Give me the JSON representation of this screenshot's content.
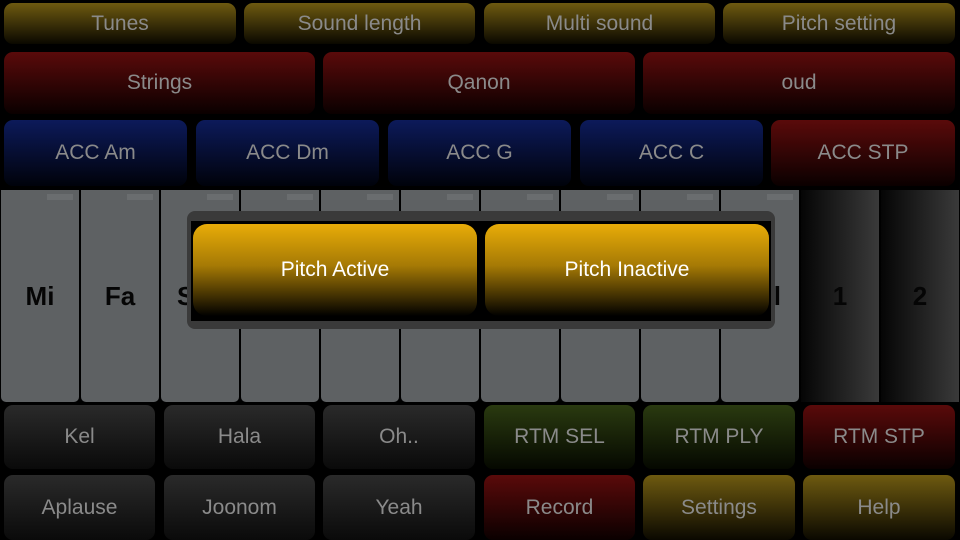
{
  "top_menu": [
    "Tunes",
    "Sound length",
    "Multi sound",
    "Pitch setting"
  ],
  "instruments": [
    "Strings",
    "Qanon",
    "oud"
  ],
  "accompaniment": [
    "ACC Am",
    "ACC Dm",
    "ACC G",
    "ACC C",
    "ACC STP"
  ],
  "keys": [
    "Mi",
    "Fa",
    "S",
    "",
    "",
    "",
    "",
    "",
    "",
    "l"
  ],
  "dark_keys": [
    "1",
    "2"
  ],
  "row4": [
    "Kel",
    "Hala",
    "Oh..",
    "RTM SEL",
    "RTM PLY",
    "RTM STP"
  ],
  "row5": [
    "Aplause",
    "Joonom",
    "Yeah",
    "Record",
    "Settings",
    "Help"
  ],
  "dialog": {
    "active": "Pitch Active",
    "inactive": "Pitch Inactive"
  }
}
